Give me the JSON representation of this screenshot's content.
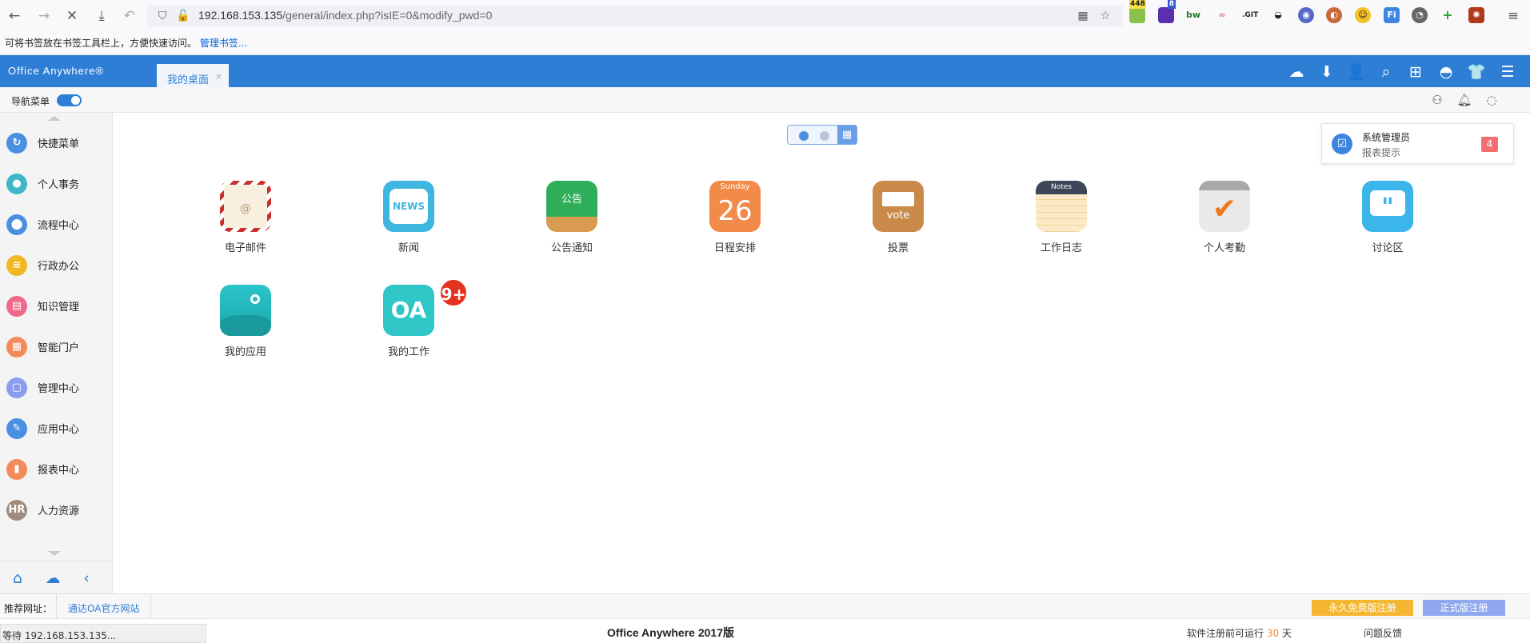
{
  "browser": {
    "url_host": "192.168.153.135",
    "url_path": "/general/index.php?isIE=0&modify_pwd=0",
    "bookmark_hint": "可将书签放在书签工具栏上，方便快速访问。",
    "bookmark_link": "管理书签...",
    "ext_badge_1": "448",
    "ext_badge_2": "8",
    "ext_bw": "bw",
    "ext_git": ".GIT"
  },
  "header": {
    "logo": "Office Anywhere®",
    "tab_label": "我的桌面",
    "tab_close": "×"
  },
  "subbar": {
    "nav_menu_label": "导航菜单"
  },
  "sidebar": {
    "items": [
      {
        "label": "快捷菜单",
        "color": "#4a8fe0",
        "glyph": "↻"
      },
      {
        "label": "个人事务",
        "color": "#3fb7c9",
        "glyph": "●"
      },
      {
        "label": "流程中心",
        "color": "#4a8fe0",
        "glyph": "⬤"
      },
      {
        "label": "行政办公",
        "color": "#f2b823",
        "glyph": "≋"
      },
      {
        "label": "知识管理",
        "color": "#ef6a8a",
        "glyph": "▤"
      },
      {
        "label": "智能门户",
        "color": "#f38a5a",
        "glyph": "▦"
      },
      {
        "label": "管理中心",
        "color": "#8a9cf0",
        "glyph": "▢"
      },
      {
        "label": "应用中心",
        "color": "#4a8fe0",
        "glyph": "✎"
      },
      {
        "label": "报表中心",
        "color": "#f38a5a",
        "glyph": "▮"
      },
      {
        "label": "人力资源",
        "color": "#9e8b7e",
        "glyph": "HR"
      }
    ]
  },
  "apps": [
    {
      "label": "电子邮件"
    },
    {
      "label": "新闻",
      "icon_text": "NEWS"
    },
    {
      "label": "公告通知",
      "icon_text": "公告"
    },
    {
      "label": "日程安排",
      "icon_top": "Sunday",
      "icon_text": "26"
    },
    {
      "label": "投票",
      "icon_text": "vote"
    },
    {
      "label": "工作日志",
      "icon_top": "Notes"
    },
    {
      "label": "个人考勤"
    },
    {
      "label": "讨论区"
    },
    {
      "label": "我的应用"
    },
    {
      "label": "我的工作",
      "icon_text": "OA",
      "badge": "9+"
    }
  ],
  "notification": {
    "title": "系统管理员",
    "subtitle": "报表提示",
    "count": "4"
  },
  "footer": {
    "recommend_label": "推荐网址：",
    "recommend_link": "通达OA官方网站",
    "btn_free": "永久免费版注册",
    "btn_official": "正式版注册",
    "status": "等待 192.168.153.135...",
    "brand": "Office Anywhere 2017版",
    "reg_prefix": "软件注册前可运行",
    "reg_days": "30",
    "reg_suffix": "天",
    "feedback": "问题反馈"
  },
  "colors": {
    "accent": "#2f7ed6",
    "notify_count": "#f07070",
    "btn_free": "#f5b731",
    "btn_official": "#8fa8f0"
  }
}
